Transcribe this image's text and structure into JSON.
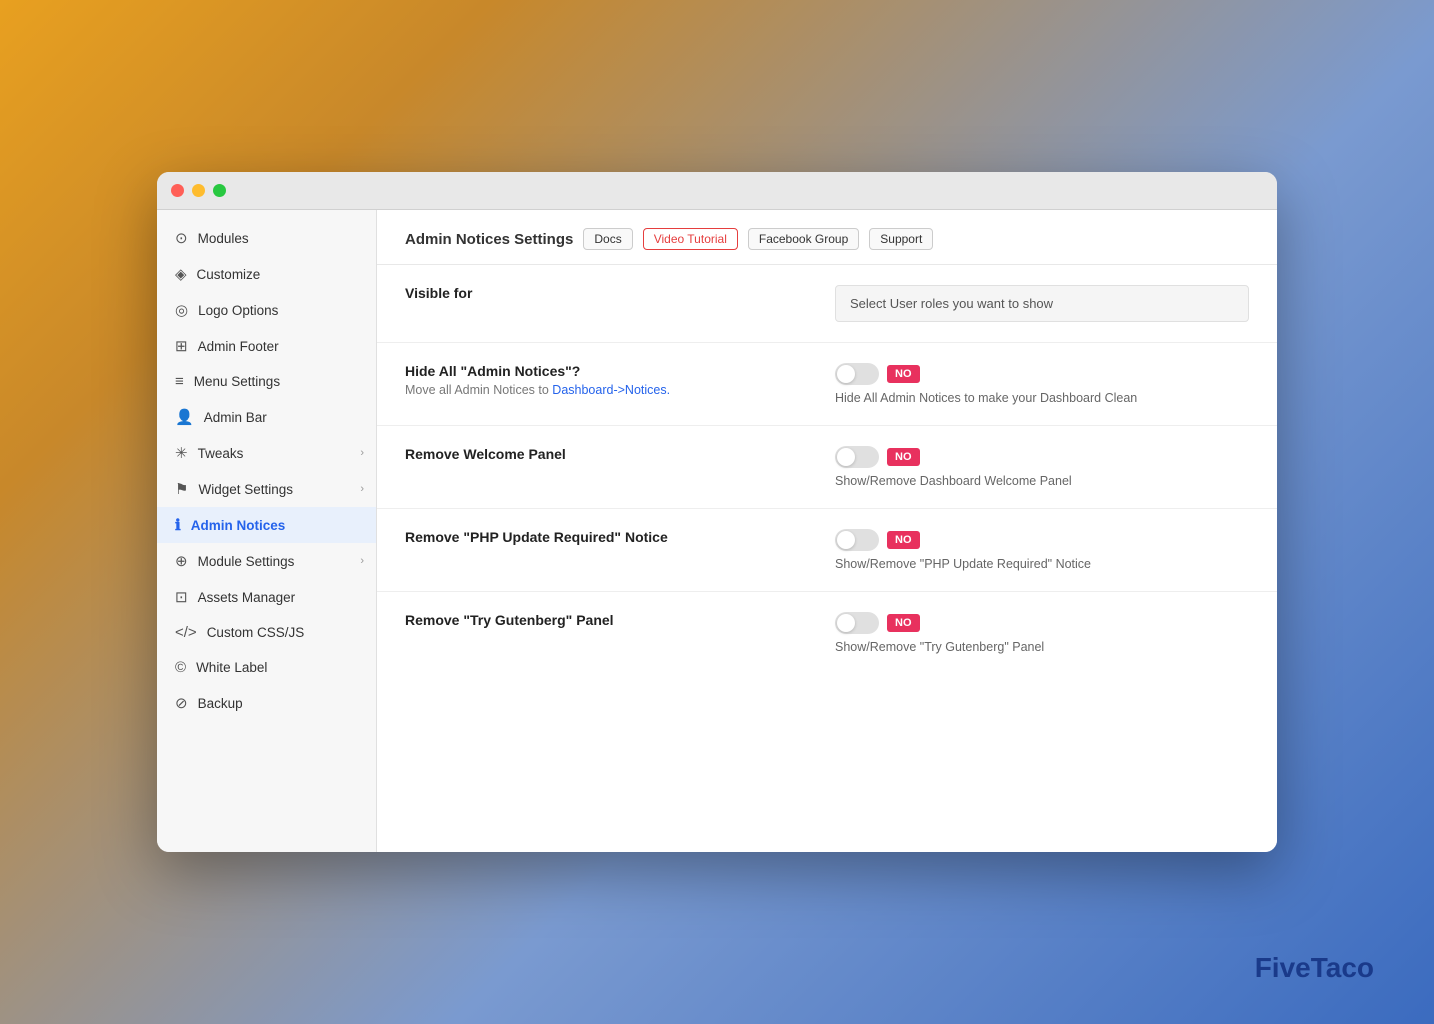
{
  "window": {
    "title": "Admin Notices Settings"
  },
  "sidebar": {
    "items": [
      {
        "id": "modules",
        "label": "Modules",
        "icon": "⊙",
        "hasChevron": false,
        "active": false
      },
      {
        "id": "customize",
        "label": "Customize",
        "icon": "◈",
        "hasChevron": false,
        "active": false
      },
      {
        "id": "logo-options",
        "label": "Logo Options",
        "icon": "◎",
        "hasChevron": false,
        "active": false
      },
      {
        "id": "admin-footer",
        "label": "Admin Footer",
        "icon": "⊞",
        "hasChevron": false,
        "active": false
      },
      {
        "id": "menu-settings",
        "label": "Menu Settings",
        "icon": "≡",
        "hasChevron": false,
        "active": false
      },
      {
        "id": "admin-bar",
        "label": "Admin Bar",
        "icon": "👤",
        "hasChevron": false,
        "active": false
      },
      {
        "id": "tweaks",
        "label": "Tweaks",
        "icon": "✳",
        "hasChevron": true,
        "active": false
      },
      {
        "id": "widget-settings",
        "label": "Widget Settings",
        "icon": "⚑",
        "hasChevron": true,
        "active": false
      },
      {
        "id": "admin-notices",
        "label": "Admin Notices",
        "icon": "ℹ",
        "hasChevron": false,
        "active": true
      },
      {
        "id": "module-settings",
        "label": "Module Settings",
        "icon": "⊕",
        "hasChevron": true,
        "active": false
      },
      {
        "id": "assets-manager",
        "label": "Assets Manager",
        "icon": "⊡",
        "hasChevron": false,
        "active": false
      },
      {
        "id": "custom-css-js",
        "label": "Custom CSS/JS",
        "icon": "</>",
        "hasChevron": false,
        "active": false
      },
      {
        "id": "white-label",
        "label": "White Label",
        "icon": "©",
        "hasChevron": false,
        "active": false
      },
      {
        "id": "backup",
        "label": "Backup",
        "icon": "⊘",
        "hasChevron": false,
        "active": false
      }
    ]
  },
  "header": {
    "title": "Admin Notices Settings",
    "tags": [
      {
        "id": "docs",
        "label": "Docs",
        "style": "docs"
      },
      {
        "id": "video-tutorial",
        "label": "Video Tutorial",
        "style": "video"
      },
      {
        "id": "facebook-group",
        "label": "Facebook Group",
        "style": "facebook"
      },
      {
        "id": "support",
        "label": "Support",
        "style": "support"
      }
    ]
  },
  "settings": [
    {
      "id": "visible-for",
      "label": "Visible for",
      "sublabel": "",
      "right_type": "select",
      "select_placeholder": "Select User roles you want to show",
      "toggle": null,
      "desc": ""
    },
    {
      "id": "hide-admin-notices",
      "label": "Hide All \"Admin Notices\"?",
      "sublabel": "Move all Admin Notices to Dashboard->Notices.",
      "sublabel_link": "Dashboard->Notices.",
      "right_type": "toggle",
      "toggle_state": "NO",
      "desc": "Hide All Admin Notices to make your Dashboard Clean"
    },
    {
      "id": "remove-welcome-panel",
      "label": "Remove Welcome Panel",
      "sublabel": "",
      "right_type": "toggle",
      "toggle_state": "NO",
      "desc": "Show/Remove Dashboard Welcome Panel"
    },
    {
      "id": "remove-php-notice",
      "label": "Remove \"PHP Update Required\" Notice",
      "sublabel": "",
      "right_type": "toggle",
      "toggle_state": "NO",
      "desc": "Show/Remove \"PHP Update Required\" Notice"
    },
    {
      "id": "remove-gutenberg",
      "label": "Remove \"Try Gutenberg\" Panel",
      "sublabel": "",
      "right_type": "toggle",
      "toggle_state": "NO",
      "desc": "Show/Remove \"Try Gutenberg\" Panel"
    }
  ],
  "brand": {
    "name": "FiveTaco"
  },
  "colors": {
    "accent": "#2563eb",
    "toggle_no": "#e8315e",
    "active_bg": "#e8f0fc"
  }
}
